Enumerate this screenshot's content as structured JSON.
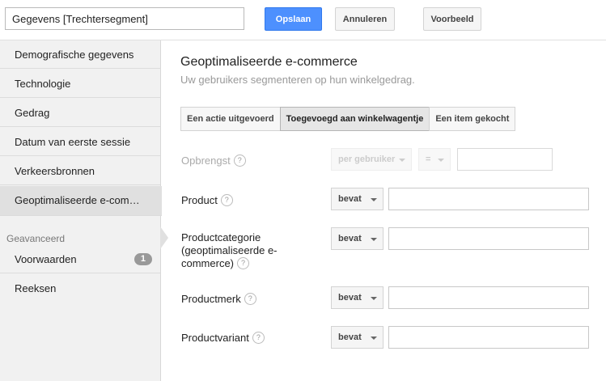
{
  "header": {
    "segment_name": "Gegevens [Trechtersegment]",
    "save_label": "Opslaan",
    "cancel_label": "Annuleren",
    "preview_label": "Voorbeeld"
  },
  "sidebar": {
    "items": [
      {
        "label": "Demografische gegevens"
      },
      {
        "label": "Technologie"
      },
      {
        "label": "Gedrag"
      },
      {
        "label": "Datum van eerste sessie"
      },
      {
        "label": "Verkeersbronnen"
      },
      {
        "label": "Geoptimaliseerde e-com…"
      }
    ],
    "advanced_heading": "Geavanceerd",
    "advanced_items": [
      {
        "label": "Voorwaarden",
        "badge": "1"
      },
      {
        "label": "Reeksen"
      }
    ]
  },
  "main": {
    "title": "Geoptimaliseerde e-commerce",
    "subtitle": "Uw gebruikers segmenteren op hun winkelgedrag.",
    "tabs": [
      {
        "label": "Een actie uitgevoerd"
      },
      {
        "label": "Toegevoegd aan winkelwagentje"
      },
      {
        "label": "Een item gekocht"
      }
    ],
    "help_glyph": "?",
    "rows": {
      "revenue": {
        "label": "Opbrengst",
        "scope": "per gebruiker",
        "operator": "=",
        "value": ""
      },
      "product": {
        "label": "Product",
        "operator": "bevat",
        "value": ""
      },
      "category": {
        "label_line1": "Productcategorie",
        "label_line2": "(geoptimaliseerde e-",
        "label_line3": "commerce)",
        "operator": "bevat",
        "value": ""
      },
      "brand": {
        "label": "Productmerk",
        "operator": "bevat",
        "value": ""
      },
      "variant": {
        "label": "Productvariant",
        "operator": "bevat",
        "value": ""
      }
    }
  },
  "colors": {
    "primary_button": "#4d90fe",
    "sidebar_bg": "#f1f1f1",
    "active_item_bg": "#e0e0e0"
  }
}
